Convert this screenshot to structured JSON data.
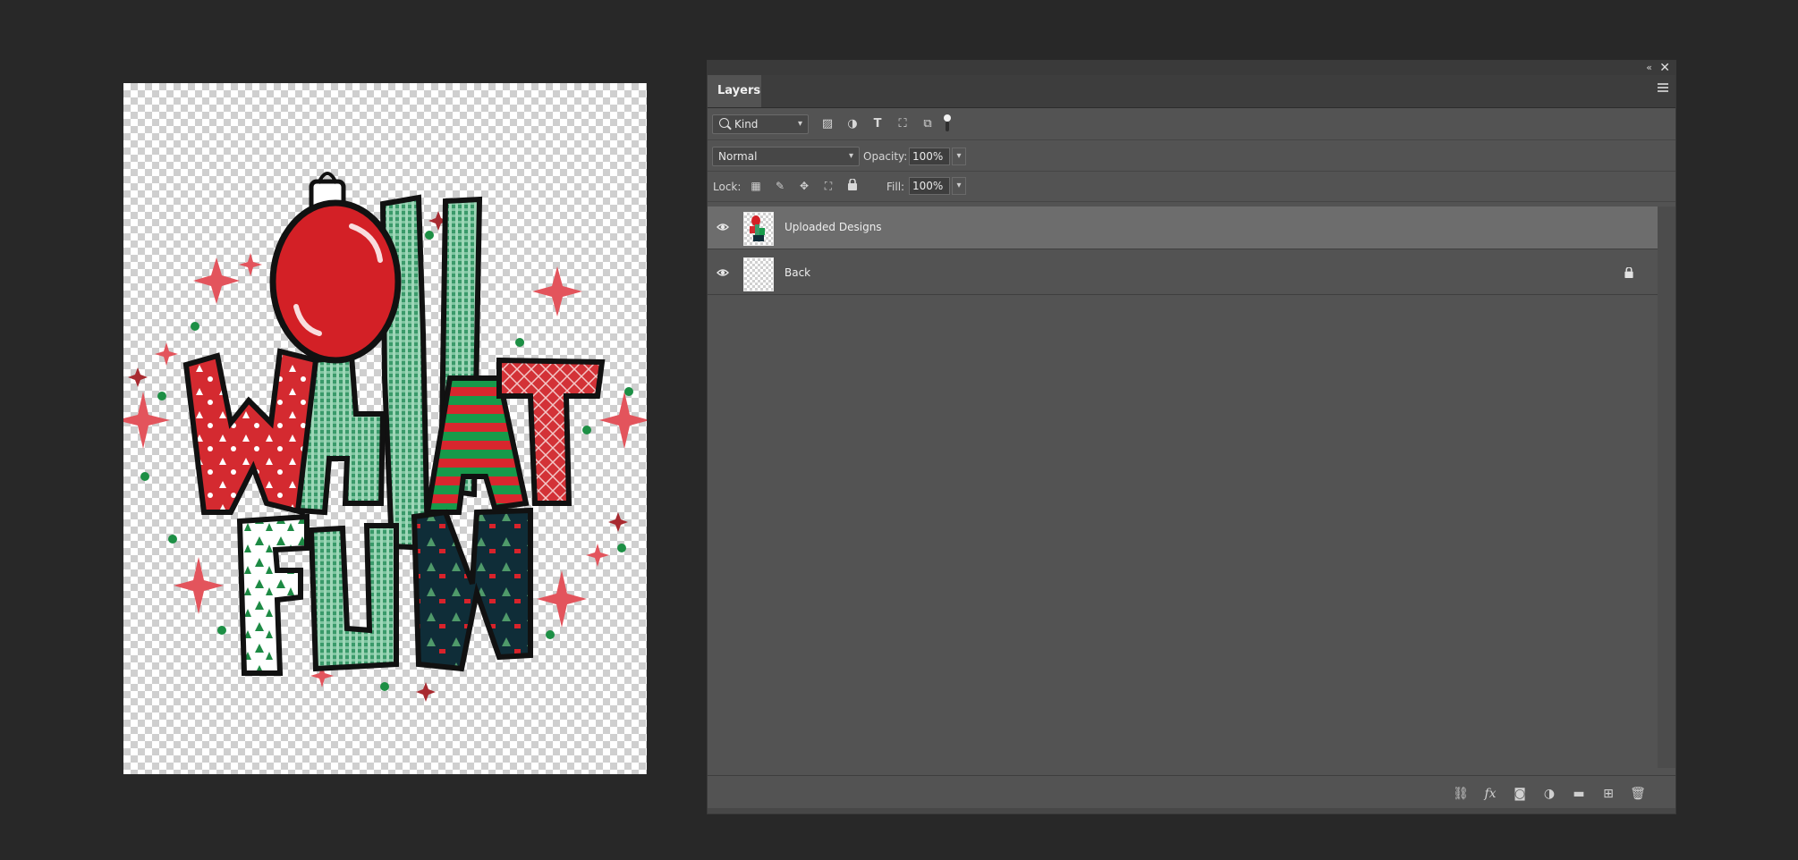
{
  "panel": {
    "tab_label": "Layers",
    "collapse_glyph": "«",
    "close_glyph": "✕",
    "filter": {
      "kind_label": "Kind"
    },
    "blend_mode": "Normal",
    "opacity_label": "Opacity:",
    "opacity_value": "100%",
    "lock_label": "Lock:",
    "fill_label": "Fill:",
    "fill_value": "100%",
    "layers": [
      {
        "name": "Uploaded Designs",
        "visible": true,
        "selected": true,
        "locked": false
      },
      {
        "name": "Back",
        "visible": true,
        "selected": false,
        "locked": true
      }
    ],
    "bottom_icons": [
      "link-icon",
      "fx-icon",
      "mask-icon",
      "adjustment-icon",
      "folder-icon",
      "new-layer-icon",
      "trash-icon"
    ],
    "fx_label": "fx"
  },
  "canvas": {
    "artwork_text": [
      "OH",
      "WHAT",
      "FUN"
    ]
  }
}
